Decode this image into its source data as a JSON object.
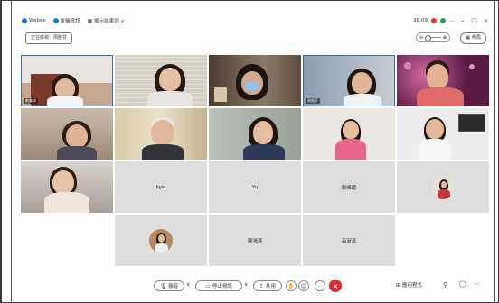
{
  "titlebar": {
    "app_name": "Webex",
    "meeting_name": "會議資訊",
    "info_label": "顯示結果例 ∨",
    "time": "38:09",
    "minimize": "–",
    "restore": "□",
    "close": "×"
  },
  "subbar": {
    "viewing_label": "正在檢視：周雅芬",
    "layout_label": "佈局"
  },
  "tiles": [
    {
      "name": "劉美如",
      "kind": "video",
      "bg": "#c9a68e"
    },
    {
      "name": "",
      "kind": "video",
      "bg": "#d9d2c4"
    },
    {
      "name": "",
      "kind": "video",
      "bg": "#7c6c5c"
    },
    {
      "name": "周雅芬",
      "kind": "video",
      "bg": "#9aa8b8"
    },
    {
      "name": "",
      "kind": "video",
      "bg": "#8a2f5f"
    },
    {
      "name": "",
      "kind": "video",
      "bg": "#b6a596"
    },
    {
      "name": "",
      "kind": "video",
      "bg": "#cfc3a6"
    },
    {
      "name": "",
      "kind": "video",
      "bg": "#aab1a8"
    },
    {
      "name": "",
      "kind": "video",
      "bg": "#e5e2dc"
    },
    {
      "name": "",
      "kind": "video",
      "bg": "#e8e8e8"
    },
    {
      "name": "",
      "kind": "video",
      "bg": "#c3bdb6"
    },
    {
      "name": "kyw",
      "kind": "text"
    },
    {
      "name": "Yu",
      "kind": "text"
    },
    {
      "name": "鄭雅蘭",
      "kind": "text"
    },
    {
      "name": "",
      "kind": "avatar"
    },
    {
      "name": "",
      "kind": "avatar"
    },
    {
      "name": "陳鴻蓉",
      "kind": "text"
    },
    {
      "name": "高淑真",
      "kind": "text"
    }
  ],
  "controls": {
    "mute": "靜音",
    "stop_video": "停止視訊",
    "share": "共用",
    "apps": "應用程式"
  },
  "colors": {
    "accent": "#2d6fcf",
    "leave": "#e0282e",
    "recording": "#e33333"
  }
}
